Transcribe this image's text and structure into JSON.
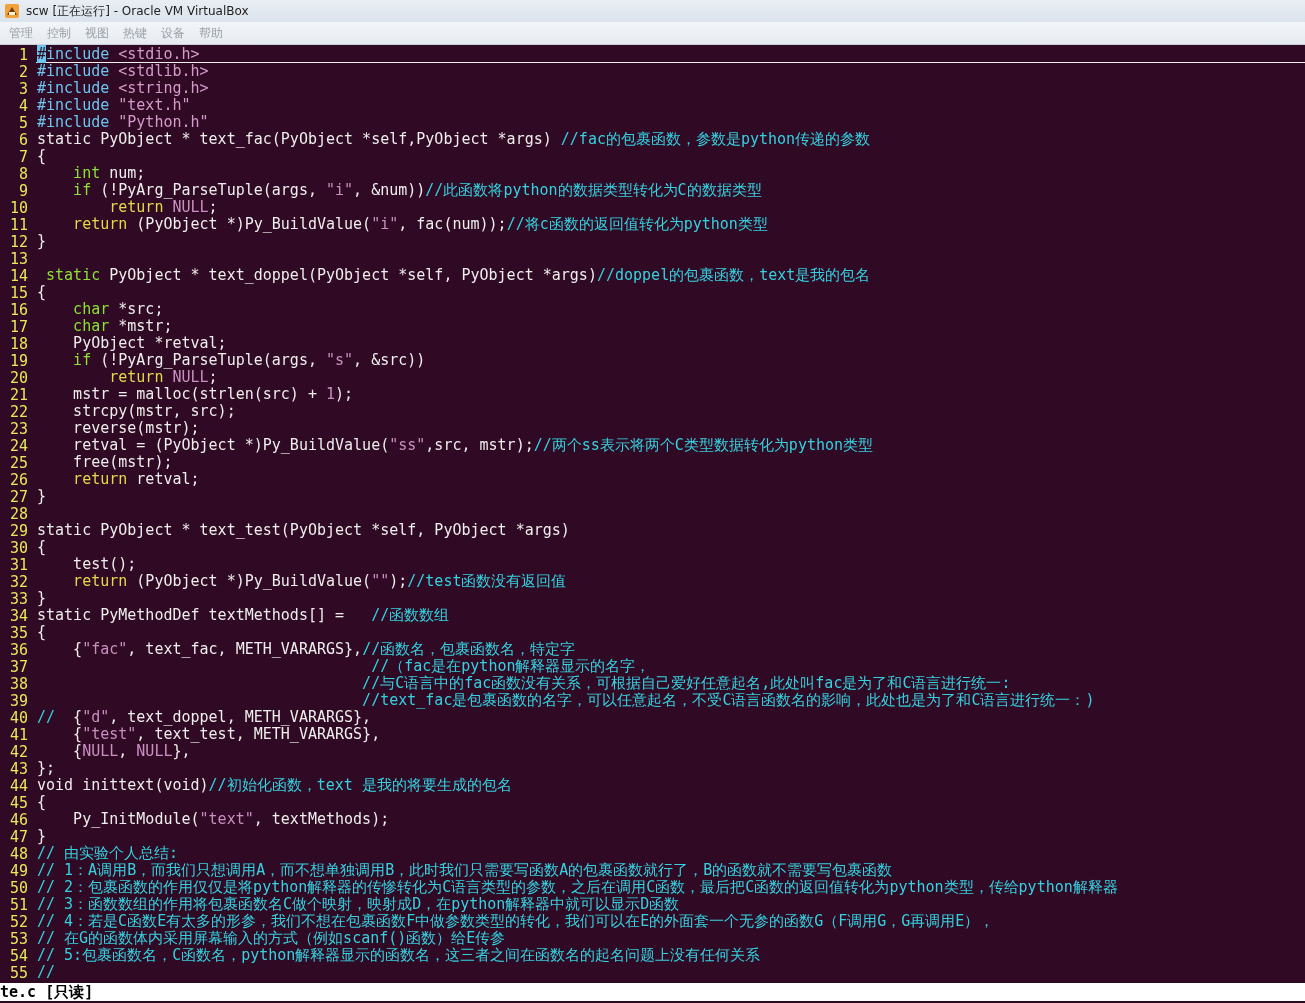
{
  "window": {
    "title": "scw [正在运行] - Oracle VM VirtualBox"
  },
  "menu": [
    {
      "label": "管理",
      "disabled": true
    },
    {
      "label": "控制",
      "disabled": true
    },
    {
      "label": "视图",
      "disabled": true
    },
    {
      "label": "热键",
      "disabled": true
    },
    {
      "label": "设备",
      "disabled": true
    },
    {
      "label": "帮助",
      "disabled": true
    }
  ],
  "editor": {
    "lines": [
      {
        "number": "1",
        "current": true,
        "segments": [
          {
            "kind": "cursor",
            "text": "#"
          },
          {
            "kind": "pre",
            "text": "include "
          },
          {
            "kind": "inc",
            "text": "<stdio.h>"
          }
        ]
      },
      {
        "number": "2",
        "current": false,
        "segments": [
          {
            "kind": "pre",
            "text": "#include "
          },
          {
            "kind": "inc",
            "text": "<stdlib.h>"
          }
        ]
      },
      {
        "number": "3",
        "current": false,
        "segments": [
          {
            "kind": "pre",
            "text": "#include "
          },
          {
            "kind": "inc",
            "text": "<string.h>"
          }
        ]
      },
      {
        "number": "4",
        "current": false,
        "segments": [
          {
            "kind": "pre",
            "text": "#include "
          },
          {
            "kind": "inc",
            "text": "\"text.h\""
          }
        ]
      },
      {
        "number": "5",
        "current": false,
        "segments": [
          {
            "kind": "pre",
            "text": "#include "
          },
          {
            "kind": "inc",
            "text": "\"Python.h\""
          }
        ]
      },
      {
        "number": "6",
        "current": false,
        "segments": [
          {
            "kind": "code",
            "text": "static PyObject * text_fac(PyObject *self,PyObject *args) "
          },
          {
            "kind": "comment",
            "text": "//fac的包裹函数，参数是python传递的参数"
          }
        ]
      },
      {
        "number": "7",
        "current": false,
        "segments": [
          {
            "kind": "code",
            "text": "{"
          }
        ]
      },
      {
        "number": "8",
        "current": false,
        "segments": [
          {
            "kind": "type",
            "text": "    int"
          },
          {
            "kind": "code",
            "text": " num;"
          }
        ]
      },
      {
        "number": "9",
        "current": false,
        "segments": [
          {
            "kind": "type",
            "text": "    if"
          },
          {
            "kind": "code",
            "text": " (!PyArg_ParseTuple(args, "
          },
          {
            "kind": "str",
            "text": "\"i\""
          },
          {
            "kind": "code",
            "text": ", &num))"
          },
          {
            "kind": "comment",
            "text": "//此函数将python的数据类型转化为C的数据类型"
          }
        ]
      },
      {
        "number": "10",
        "current": false,
        "segments": [
          {
            "kind": "ret",
            "text": "        return"
          },
          {
            "kind": "str",
            "text": " NULL"
          },
          {
            "kind": "code",
            "text": ";"
          }
        ]
      },
      {
        "number": "11",
        "current": false,
        "segments": [
          {
            "kind": "ret",
            "text": "    return"
          },
          {
            "kind": "code",
            "text": " (PyObject *)Py_BuildValue("
          },
          {
            "kind": "str",
            "text": "\"i\""
          },
          {
            "kind": "code",
            "text": ", fac(num));"
          },
          {
            "kind": "comment",
            "text": "//将c函数的返回值转化为python类型"
          }
        ]
      },
      {
        "number": "12",
        "current": false,
        "segments": [
          {
            "kind": "code",
            "text": "}"
          }
        ]
      },
      {
        "number": "13",
        "current": false
      },
      {
        "number": "14",
        "current": false,
        "segments": [
          {
            "kind": "type",
            "text": " static"
          },
          {
            "kind": "code",
            "text": " PyObject * text_doppel(PyObject *self, PyObject *args)"
          },
          {
            "kind": "comment",
            "text": "//doppel的包裹函数，text是我的包名"
          }
        ]
      },
      {
        "number": "15",
        "current": false,
        "segments": [
          {
            "kind": "code",
            "text": "{"
          }
        ]
      },
      {
        "number": "16",
        "current": false,
        "segments": [
          {
            "kind": "type",
            "text": "    char"
          },
          {
            "kind": "code",
            "text": " *src;"
          }
        ]
      },
      {
        "number": "17",
        "current": false,
        "segments": [
          {
            "kind": "type",
            "text": "    char"
          },
          {
            "kind": "code",
            "text": " *mstr;"
          }
        ]
      },
      {
        "number": "18",
        "current": false,
        "segments": [
          {
            "kind": "code",
            "text": "    PyObject *retval;"
          }
        ]
      },
      {
        "number": "19",
        "current": false,
        "segments": [
          {
            "kind": "type",
            "text": "    if"
          },
          {
            "kind": "code",
            "text": " (!PyArg_ParseTuple(args, "
          },
          {
            "kind": "str",
            "text": "\"s\""
          },
          {
            "kind": "code",
            "text": ", &src))"
          }
        ]
      },
      {
        "number": "20",
        "current": false,
        "segments": [
          {
            "kind": "ret",
            "text": "        return"
          },
          {
            "kind": "str",
            "text": " NULL"
          },
          {
            "kind": "code",
            "text": ";"
          }
        ]
      },
      {
        "number": "21",
        "current": false,
        "segments": [
          {
            "kind": "code",
            "text": "    mstr = malloc(strlen(src) + "
          },
          {
            "kind": "str",
            "text": "1"
          },
          {
            "kind": "code",
            "text": ");"
          }
        ]
      },
      {
        "number": "22",
        "current": false,
        "segments": [
          {
            "kind": "code",
            "text": "    strcpy(mstr, src);"
          }
        ]
      },
      {
        "number": "23",
        "current": false,
        "segments": [
          {
            "kind": "code",
            "text": "    reverse(mstr);"
          }
        ]
      },
      {
        "number": "24",
        "current": false,
        "segments": [
          {
            "kind": "code",
            "text": "    retval = (PyObject *)Py_BuildValue("
          },
          {
            "kind": "str",
            "text": "\"ss\""
          },
          {
            "kind": "code",
            "text": ",src, mstr);"
          },
          {
            "kind": "comment",
            "text": "//两个ss表示将两个C类型数据转化为python类型"
          }
        ]
      },
      {
        "number": "25",
        "current": false,
        "segments": [
          {
            "kind": "code",
            "text": "    free(mstr);"
          }
        ]
      },
      {
        "number": "26",
        "current": false,
        "segments": [
          {
            "kind": "ret",
            "text": "    return"
          },
          {
            "kind": "code",
            "text": " retval;"
          }
        ]
      },
      {
        "number": "27",
        "current": false,
        "segments": [
          {
            "kind": "code",
            "text": "}"
          }
        ]
      },
      {
        "number": "28",
        "current": false
      },
      {
        "number": "29",
        "current": false,
        "segments": [
          {
            "kind": "code",
            "text": "static PyObject * text_test(PyObject *self, PyObject *args)"
          }
        ]
      },
      {
        "number": "30",
        "current": false,
        "segments": [
          {
            "kind": "code",
            "text": "{"
          }
        ]
      },
      {
        "number": "31",
        "current": false,
        "segments": [
          {
            "kind": "code",
            "text": "    test();"
          }
        ]
      },
      {
        "number": "32",
        "current": false,
        "segments": [
          {
            "kind": "ret",
            "text": "    return"
          },
          {
            "kind": "code",
            "text": " (PyObject *)Py_BuildValue("
          },
          {
            "kind": "str",
            "text": "\"\""
          },
          {
            "kind": "code",
            "text": ");"
          },
          {
            "kind": "comment",
            "text": "//test函数没有返回值"
          }
        ]
      },
      {
        "number": "33",
        "current": false,
        "segments": [
          {
            "kind": "code",
            "text": "}"
          }
        ]
      },
      {
        "number": "34",
        "current": false,
        "segments": [
          {
            "kind": "code",
            "text": "static PyMethodDef textMethods[] =   "
          },
          {
            "kind": "comment",
            "text": "//函数数组"
          }
        ]
      },
      {
        "number": "35",
        "current": false,
        "segments": [
          {
            "kind": "code",
            "text": "{"
          }
        ]
      },
      {
        "number": "36",
        "current": false,
        "segments": [
          {
            "kind": "code",
            "text": "    {"
          },
          {
            "kind": "str",
            "text": "\"fac\""
          },
          {
            "kind": "code",
            "text": ", text_fac, METH_VARARGS},"
          },
          {
            "kind": "comment",
            "text": "//函数名，包裹函数名，特定字"
          }
        ]
      },
      {
        "number": "37",
        "current": false,
        "segments": [
          {
            "kind": "comment",
            "text": "                                     //（fac是在python解释器显示的名字，"
          }
        ]
      },
      {
        "number": "38",
        "current": false,
        "segments": [
          {
            "kind": "comment",
            "text": "                                    //与C语言中的fac函数没有关系，可根据自己爱好任意起名,此处叫fac是为了和C语言进行统一:"
          }
        ]
      },
      {
        "number": "39",
        "current": false,
        "segments": [
          {
            "kind": "comment",
            "text": "                                    //text_fac是包裹函数的名字，可以任意起名，不受C语言函数名的影响，此处也是为了和C语言进行统一：)"
          }
        ]
      },
      {
        "number": "40",
        "current": false,
        "segments": [
          {
            "kind": "comment",
            "text": "//"
          },
          {
            "kind": "code",
            "text": "  {"
          },
          {
            "kind": "str",
            "text": "\"d\""
          },
          {
            "kind": "code",
            "text": ", text_doppel, METH_VARARGS},"
          }
        ]
      },
      {
        "number": "41",
        "current": false,
        "segments": [
          {
            "kind": "code",
            "text": "    {"
          },
          {
            "kind": "str",
            "text": "\"test\""
          },
          {
            "kind": "code",
            "text": ", text_test, METH_VARARGS},"
          }
        ]
      },
      {
        "number": "42",
        "current": false,
        "segments": [
          {
            "kind": "code",
            "text": "    {"
          },
          {
            "kind": "str",
            "text": "NULL"
          },
          {
            "kind": "code",
            "text": ", "
          },
          {
            "kind": "str",
            "text": "NULL"
          },
          {
            "kind": "code",
            "text": "},"
          }
        ]
      },
      {
        "number": "43",
        "current": false,
        "segments": [
          {
            "kind": "code",
            "text": "};"
          }
        ]
      },
      {
        "number": "44",
        "current": false,
        "segments": [
          {
            "kind": "code",
            "text": "void inittext(void)"
          },
          {
            "kind": "comment",
            "text": "//初始化函数，text 是我的将要生成的包名"
          }
        ]
      },
      {
        "number": "45",
        "current": false,
        "segments": [
          {
            "kind": "code",
            "text": "{"
          }
        ]
      },
      {
        "number": "46",
        "current": false,
        "segments": [
          {
            "kind": "code",
            "text": "    Py_InitModule("
          },
          {
            "kind": "str",
            "text": "\"text\""
          },
          {
            "kind": "code",
            "text": ", textMethods);"
          }
        ]
      },
      {
        "number": "47",
        "current": false,
        "segments": [
          {
            "kind": "code",
            "text": "}"
          }
        ]
      },
      {
        "number": "48",
        "current": false,
        "segments": [
          {
            "kind": "comment",
            "text": "// 由实验个人总结:"
          }
        ]
      },
      {
        "number": "49",
        "current": false,
        "segments": [
          {
            "kind": "comment",
            "text": "// 1：A调用B，而我们只想调用A，而不想单独调用B，此时我们只需要写函数A的包裹函数就行了，B的函数就不需要写包裹函数"
          }
        ]
      },
      {
        "number": "50",
        "current": false,
        "segments": [
          {
            "kind": "comment",
            "text": "// 2：包裹函数的作用仅仅是将python解释器的传惨转化为C语言类型的参数，之后在调用C函数，最后把C函数的返回值转化为python类型，传给python解释器"
          }
        ]
      },
      {
        "number": "51",
        "current": false,
        "segments": [
          {
            "kind": "comment",
            "text": "// 3：函数数组的作用将包裹函数名C做个映射，映射成D，在python解释器中就可以显示D函数"
          }
        ]
      },
      {
        "number": "52",
        "current": false,
        "segments": [
          {
            "kind": "comment",
            "text": "// 4：若是C函数E有太多的形参，我们不想在包裹函数F中做参数类型的转化，我们可以在E的外面套一个无参的函数G（F调用G，G再调用E），"
          }
        ]
      },
      {
        "number": "53",
        "current": false,
        "segments": [
          {
            "kind": "comment",
            "text": "// 在G的函数体内采用屏幕输入的方式（例如scanf()函数）给E传参"
          }
        ]
      },
      {
        "number": "54",
        "current": false,
        "segments": [
          {
            "kind": "comment",
            "text": "// 5:包裹函数名，C函数名，python解释器显示的函数名，这三者之间在函数名的起名问题上没有任何关系"
          }
        ]
      },
      {
        "number": "55",
        "current": false,
        "segments": [
          {
            "kind": "comment",
            "text": "//"
          }
        ]
      }
    ]
  },
  "status_line": "te.c [只读]"
}
